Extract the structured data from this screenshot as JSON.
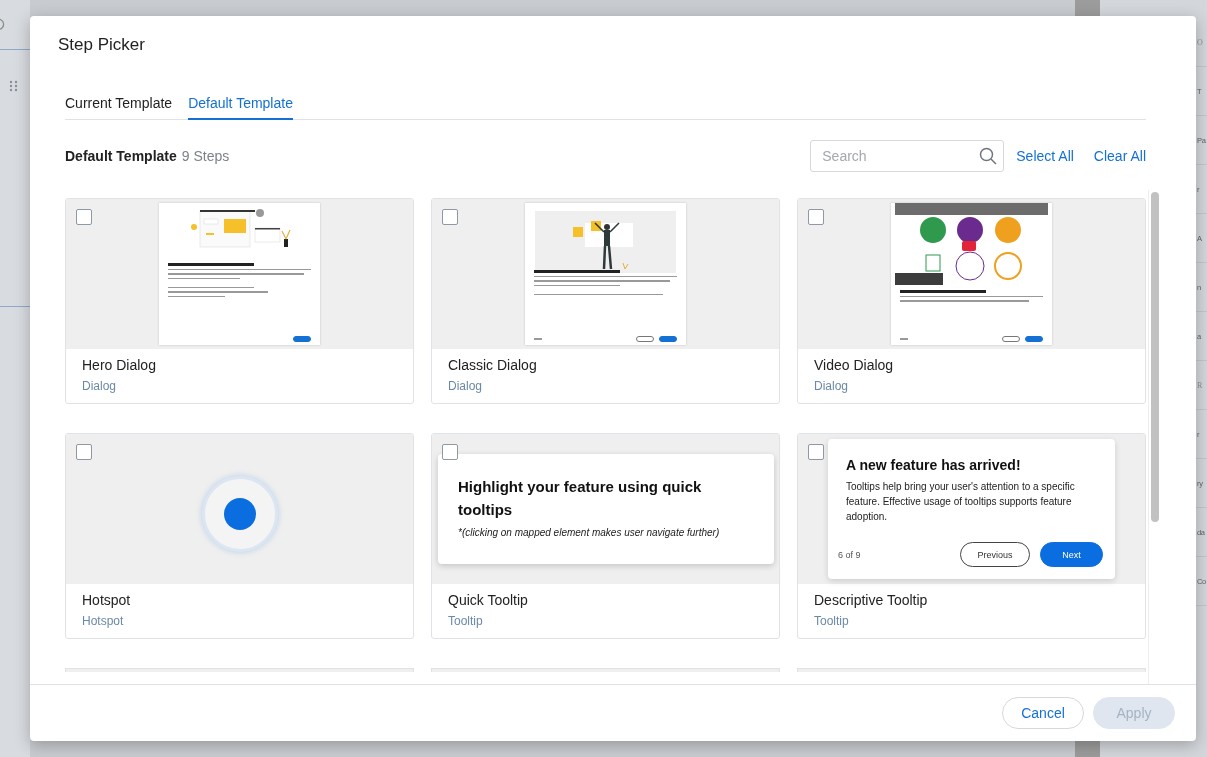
{
  "background": {
    "right_items": [
      "O",
      "T",
      "Pa",
      "r",
      "A",
      "n",
      "a",
      "R",
      "r",
      "ry",
      "da",
      "Co"
    ]
  },
  "dialog": {
    "title": "Step Picker",
    "tabs": [
      {
        "label": "Current Template",
        "selected": false
      },
      {
        "label": "Default Template",
        "selected": true
      }
    ],
    "section": {
      "title": "Default Template",
      "count": "9 Steps"
    },
    "search": {
      "placeholder": "Search"
    },
    "actions": [
      "Select All",
      "Clear All"
    ],
    "cards": [
      {
        "kind": "hero",
        "title": "Hero Dialog",
        "type": "Dialog",
        "checked": false
      },
      {
        "kind": "classic",
        "title": "Classic Dialog",
        "type": "Dialog",
        "checked": false
      },
      {
        "kind": "video",
        "title": "Video Dialog",
        "type": "Dialog",
        "checked": false
      },
      {
        "kind": "hotspot",
        "title": "Hotspot",
        "type": "Hotspot",
        "checked": false
      },
      {
        "kind": "quick",
        "title": "Quick Tooltip",
        "type": "Tooltip",
        "checked": false,
        "preview": {
          "title": "Highlight your feature using quick tooltips",
          "note": "*(clicking on mapped element makes user navigate further)"
        }
      },
      {
        "kind": "descriptive",
        "title": "Descriptive Tooltip",
        "type": "Tooltip",
        "checked": false,
        "preview": {
          "title": "A new feature has arrived!",
          "body": "Tooltips help bring your user's attention to a specific feature. Effective usage of tooltips supports feature adoption.",
          "counter": "6 of 9",
          "previous": "Previous",
          "next": "Next"
        }
      }
    ],
    "footer": {
      "cancel": "Cancel",
      "apply": {
        "label": "Apply",
        "disabled": true
      }
    }
  }
}
